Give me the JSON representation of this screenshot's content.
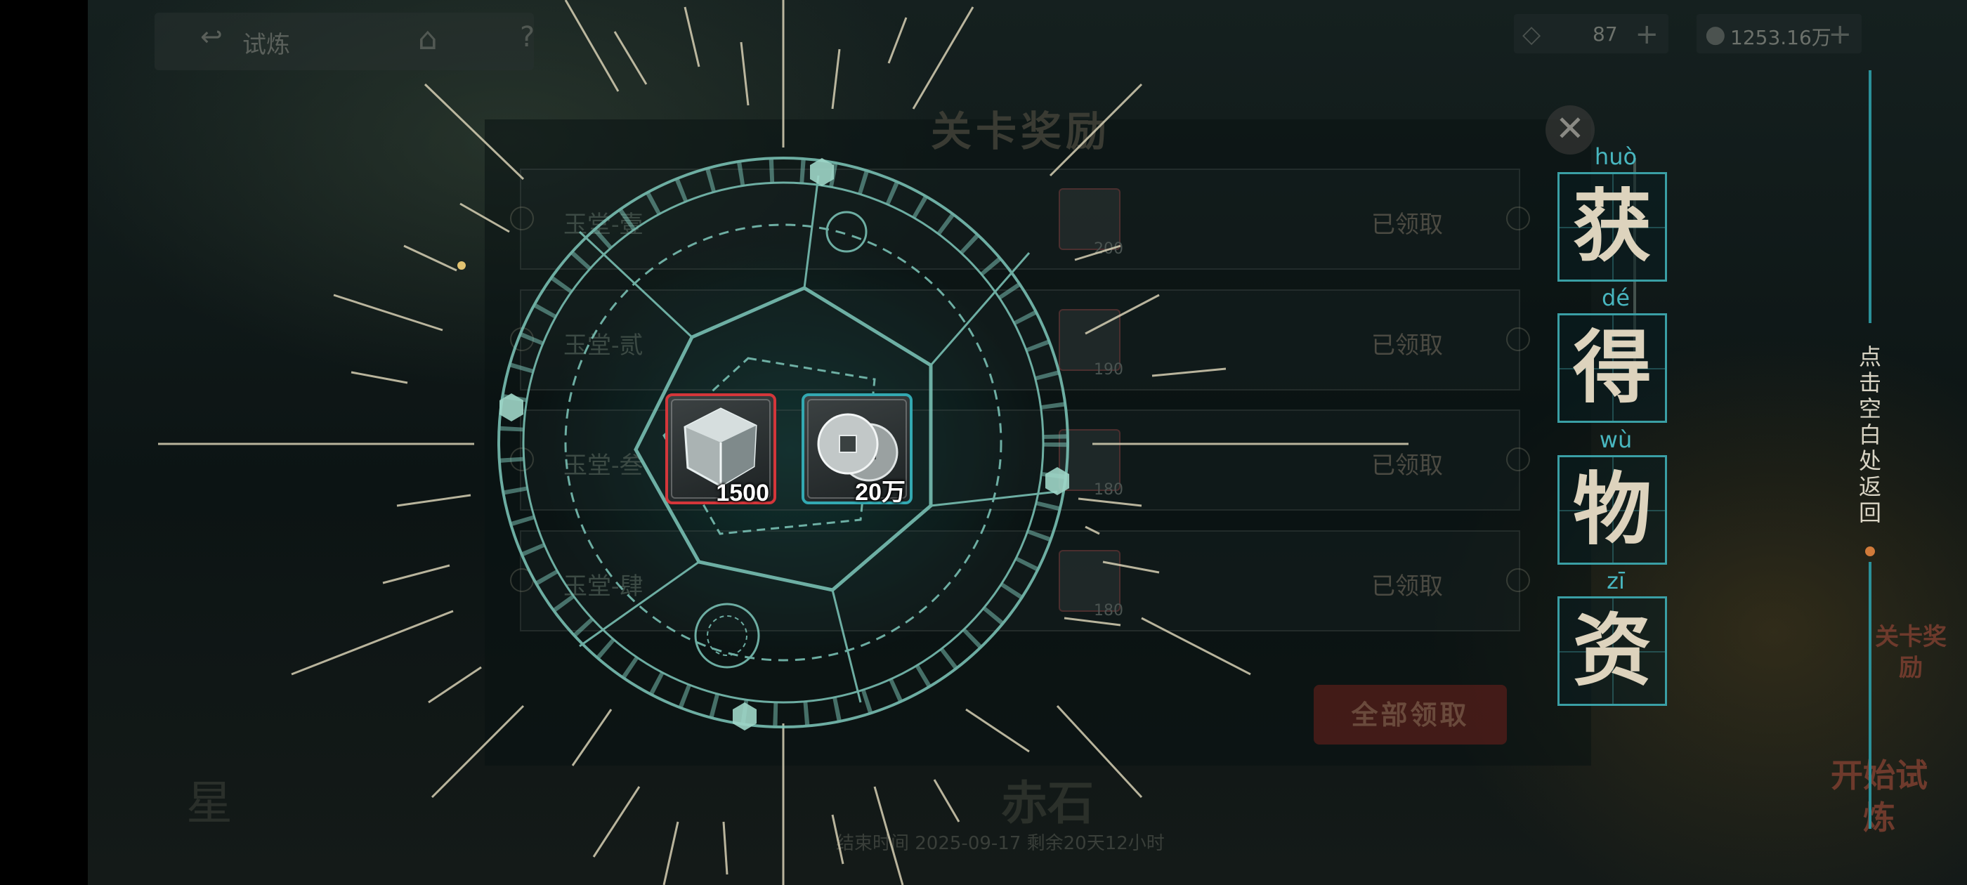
{
  "top_bar": {
    "back_icon": "return-arrow-icon",
    "back_label": "试炼",
    "home_icon": "home-icon",
    "help_icon": "question-icon",
    "resources": [
      {
        "icon": "gem-icon",
        "value": "87",
        "plus": "+"
      },
      {
        "icon": "coin-icon",
        "value": "1253.16万",
        "plus": "+"
      }
    ]
  },
  "dialog": {
    "title": "关卡奖励",
    "close_icon": "close-icon",
    "rows": [
      {
        "name": "玉堂-壹",
        "qty": "200",
        "status": "已领取"
      },
      {
        "name": "玉堂-贰",
        "qty": "190",
        "status": "已领取"
      },
      {
        "name": "玉堂-叁",
        "qty": "180",
        "status": "已领取"
      },
      {
        "name": "玉堂-肆",
        "qty": "180",
        "status": "已领取"
      }
    ],
    "claim_all": "全部领取"
  },
  "popup": {
    "title_chars": [
      {
        "pinyin": "huò",
        "char": "获"
      },
      {
        "pinyin": "dé",
        "char": "得"
      },
      {
        "pinyin": "wù",
        "char": "物"
      },
      {
        "pinyin": "zī",
        "char": "资"
      }
    ],
    "items": [
      {
        "icon": "crystal-cube-icon",
        "quantity": "1500",
        "rarity_color": "#d4363a"
      },
      {
        "icon": "silver-coins-icon",
        "quantity": "20万",
        "rarity_color": "#33a9b2"
      }
    ],
    "hint": "点击空白处返回"
  },
  "background": {
    "footer": "结束时间 2025-09-17  剩余20天12小时",
    "bottom_label": "赤石",
    "left_label": "星",
    "corner_buttons": [
      "关卡奖励",
      "开始试炼"
    ]
  },
  "colors": {
    "accent_teal": "#33a9b2",
    "accent_red": "#d4363a",
    "char_text": "#ddd3bd"
  }
}
